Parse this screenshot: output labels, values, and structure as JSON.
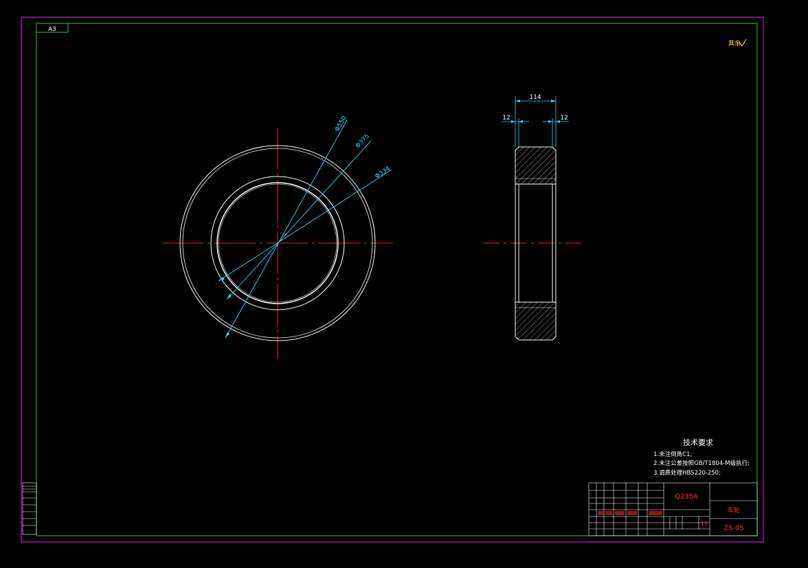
{
  "sheet": {
    "size_label": "A3",
    "roughness_mark": "其余"
  },
  "colors": {
    "outer_border": "#d21ad2",
    "frame": "#1fd11f",
    "outline": "#ffffff",
    "centerline": "#ff2020",
    "dimension": "#19e6ff",
    "hatch": "#c8c8c8",
    "title_text_red": "#ff3030"
  },
  "front_view": {
    "dimensions": [
      {
        "label": "Φ550"
      },
      {
        "label": "Φ375"
      },
      {
        "label": "Φ334"
      }
    ]
  },
  "side_view": {
    "dimensions": [
      {
        "label": "114"
      },
      {
        "label": "12"
      },
      {
        "label": "12"
      }
    ]
  },
  "technical_requirements": {
    "title": "技术要求",
    "items": [
      "1.未注倒角C1;",
      "2.未注公差按照GB/T1804-M级执行;",
      "3.调质处理HBS220-250;"
    ]
  },
  "title_block": {
    "material": "Q235A",
    "part_name": "车轮",
    "drawing_number": "ZS-05",
    "scale_value": "15"
  }
}
